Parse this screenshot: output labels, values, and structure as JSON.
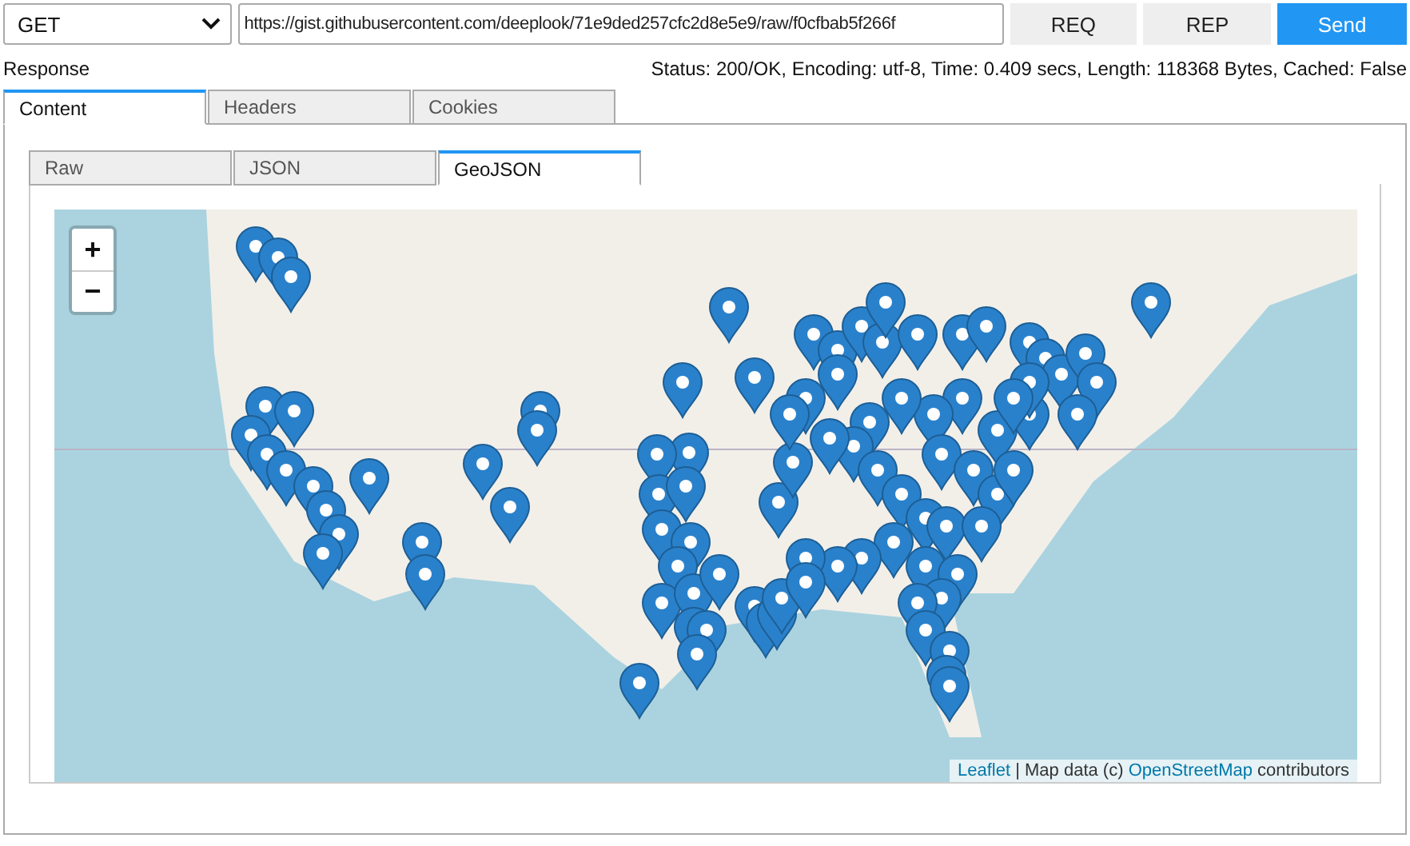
{
  "request": {
    "method": "GET",
    "url": "https://gist.githubusercontent.com/deeplook/71e9ded257cfc2d8e5e9/raw/f0cfbab5f266f",
    "buttons": [
      {
        "label": "REQ",
        "kind": "plain"
      },
      {
        "label": "REP",
        "kind": "plain"
      },
      {
        "label": "Send",
        "kind": "primary"
      }
    ]
  },
  "response": {
    "label": "Response",
    "status": "Status: 200/OK, Encoding: utf-8, Time: 0.409 secs, Length: 118368 Bytes, Cached: False"
  },
  "tabs": [
    {
      "label": "Content",
      "selected": true
    },
    {
      "label": "Headers",
      "selected": false
    },
    {
      "label": "Cookies",
      "selected": false
    }
  ],
  "content_tabs": [
    {
      "label": "Raw",
      "selected": false
    },
    {
      "label": "JSON",
      "selected": false
    },
    {
      "label": "GeoJSON",
      "selected": true
    }
  ],
  "map": {
    "zoom_in": "+",
    "zoom_out": "−",
    "attribution": [
      {
        "kind": "link",
        "text": "Leaflet"
      },
      {
        "kind": "text",
        "text": " | Map data (c) "
      },
      {
        "kind": "link",
        "text": "OpenStreetMap"
      },
      {
        "kind": "text",
        "text": " contributors"
      }
    ]
  }
}
